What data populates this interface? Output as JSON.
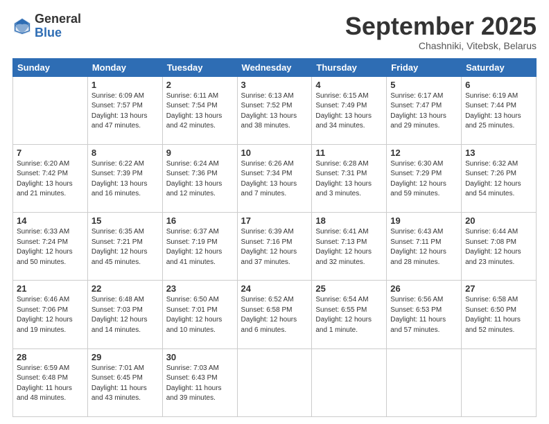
{
  "logo": {
    "general": "General",
    "blue": "Blue"
  },
  "header": {
    "month_title": "September 2025",
    "location": "Chashniki, Vitebsk, Belarus"
  },
  "weekdays": [
    "Sunday",
    "Monday",
    "Tuesday",
    "Wednesday",
    "Thursday",
    "Friday",
    "Saturday"
  ],
  "weeks": [
    [
      {
        "day": "",
        "sunrise": "",
        "sunset": "",
        "daylight": ""
      },
      {
        "day": "1",
        "sunrise": "Sunrise: 6:09 AM",
        "sunset": "Sunset: 7:57 PM",
        "daylight": "Daylight: 13 hours and 47 minutes."
      },
      {
        "day": "2",
        "sunrise": "Sunrise: 6:11 AM",
        "sunset": "Sunset: 7:54 PM",
        "daylight": "Daylight: 13 hours and 42 minutes."
      },
      {
        "day": "3",
        "sunrise": "Sunrise: 6:13 AM",
        "sunset": "Sunset: 7:52 PM",
        "daylight": "Daylight: 13 hours and 38 minutes."
      },
      {
        "day": "4",
        "sunrise": "Sunrise: 6:15 AM",
        "sunset": "Sunset: 7:49 PM",
        "daylight": "Daylight: 13 hours and 34 minutes."
      },
      {
        "day": "5",
        "sunrise": "Sunrise: 6:17 AM",
        "sunset": "Sunset: 7:47 PM",
        "daylight": "Daylight: 13 hours and 29 minutes."
      },
      {
        "day": "6",
        "sunrise": "Sunrise: 6:19 AM",
        "sunset": "Sunset: 7:44 PM",
        "daylight": "Daylight: 13 hours and 25 minutes."
      }
    ],
    [
      {
        "day": "7",
        "sunrise": "Sunrise: 6:20 AM",
        "sunset": "Sunset: 7:42 PM",
        "daylight": "Daylight: 13 hours and 21 minutes."
      },
      {
        "day": "8",
        "sunrise": "Sunrise: 6:22 AM",
        "sunset": "Sunset: 7:39 PM",
        "daylight": "Daylight: 13 hours and 16 minutes."
      },
      {
        "day": "9",
        "sunrise": "Sunrise: 6:24 AM",
        "sunset": "Sunset: 7:36 PM",
        "daylight": "Daylight: 13 hours and 12 minutes."
      },
      {
        "day": "10",
        "sunrise": "Sunrise: 6:26 AM",
        "sunset": "Sunset: 7:34 PM",
        "daylight": "Daylight: 13 hours and 7 minutes."
      },
      {
        "day": "11",
        "sunrise": "Sunrise: 6:28 AM",
        "sunset": "Sunset: 7:31 PM",
        "daylight": "Daylight: 13 hours and 3 minutes."
      },
      {
        "day": "12",
        "sunrise": "Sunrise: 6:30 AM",
        "sunset": "Sunset: 7:29 PM",
        "daylight": "Daylight: 12 hours and 59 minutes."
      },
      {
        "day": "13",
        "sunrise": "Sunrise: 6:32 AM",
        "sunset": "Sunset: 7:26 PM",
        "daylight": "Daylight: 12 hours and 54 minutes."
      }
    ],
    [
      {
        "day": "14",
        "sunrise": "Sunrise: 6:33 AM",
        "sunset": "Sunset: 7:24 PM",
        "daylight": "Daylight: 12 hours and 50 minutes."
      },
      {
        "day": "15",
        "sunrise": "Sunrise: 6:35 AM",
        "sunset": "Sunset: 7:21 PM",
        "daylight": "Daylight: 12 hours and 45 minutes."
      },
      {
        "day": "16",
        "sunrise": "Sunrise: 6:37 AM",
        "sunset": "Sunset: 7:19 PM",
        "daylight": "Daylight: 12 hours and 41 minutes."
      },
      {
        "day": "17",
        "sunrise": "Sunrise: 6:39 AM",
        "sunset": "Sunset: 7:16 PM",
        "daylight": "Daylight: 12 hours and 37 minutes."
      },
      {
        "day": "18",
        "sunrise": "Sunrise: 6:41 AM",
        "sunset": "Sunset: 7:13 PM",
        "daylight": "Daylight: 12 hours and 32 minutes."
      },
      {
        "day": "19",
        "sunrise": "Sunrise: 6:43 AM",
        "sunset": "Sunset: 7:11 PM",
        "daylight": "Daylight: 12 hours and 28 minutes."
      },
      {
        "day": "20",
        "sunrise": "Sunrise: 6:44 AM",
        "sunset": "Sunset: 7:08 PM",
        "daylight": "Daylight: 12 hours and 23 minutes."
      }
    ],
    [
      {
        "day": "21",
        "sunrise": "Sunrise: 6:46 AM",
        "sunset": "Sunset: 7:06 PM",
        "daylight": "Daylight: 12 hours and 19 minutes."
      },
      {
        "day": "22",
        "sunrise": "Sunrise: 6:48 AM",
        "sunset": "Sunset: 7:03 PM",
        "daylight": "Daylight: 12 hours and 14 minutes."
      },
      {
        "day": "23",
        "sunrise": "Sunrise: 6:50 AM",
        "sunset": "Sunset: 7:01 PM",
        "daylight": "Daylight: 12 hours and 10 minutes."
      },
      {
        "day": "24",
        "sunrise": "Sunrise: 6:52 AM",
        "sunset": "Sunset: 6:58 PM",
        "daylight": "Daylight: 12 hours and 6 minutes."
      },
      {
        "day": "25",
        "sunrise": "Sunrise: 6:54 AM",
        "sunset": "Sunset: 6:55 PM",
        "daylight": "Daylight: 12 hours and 1 minute."
      },
      {
        "day": "26",
        "sunrise": "Sunrise: 6:56 AM",
        "sunset": "Sunset: 6:53 PM",
        "daylight": "Daylight: 11 hours and 57 minutes."
      },
      {
        "day": "27",
        "sunrise": "Sunrise: 6:58 AM",
        "sunset": "Sunset: 6:50 PM",
        "daylight": "Daylight: 11 hours and 52 minutes."
      }
    ],
    [
      {
        "day": "28",
        "sunrise": "Sunrise: 6:59 AM",
        "sunset": "Sunset: 6:48 PM",
        "daylight": "Daylight: 11 hours and 48 minutes."
      },
      {
        "day": "29",
        "sunrise": "Sunrise: 7:01 AM",
        "sunset": "Sunset: 6:45 PM",
        "daylight": "Daylight: 11 hours and 43 minutes."
      },
      {
        "day": "30",
        "sunrise": "Sunrise: 7:03 AM",
        "sunset": "Sunset: 6:43 PM",
        "daylight": "Daylight: 11 hours and 39 minutes."
      },
      {
        "day": "",
        "sunrise": "",
        "sunset": "",
        "daylight": ""
      },
      {
        "day": "",
        "sunrise": "",
        "sunset": "",
        "daylight": ""
      },
      {
        "day": "",
        "sunrise": "",
        "sunset": "",
        "daylight": ""
      },
      {
        "day": "",
        "sunrise": "",
        "sunset": "",
        "daylight": ""
      }
    ]
  ]
}
